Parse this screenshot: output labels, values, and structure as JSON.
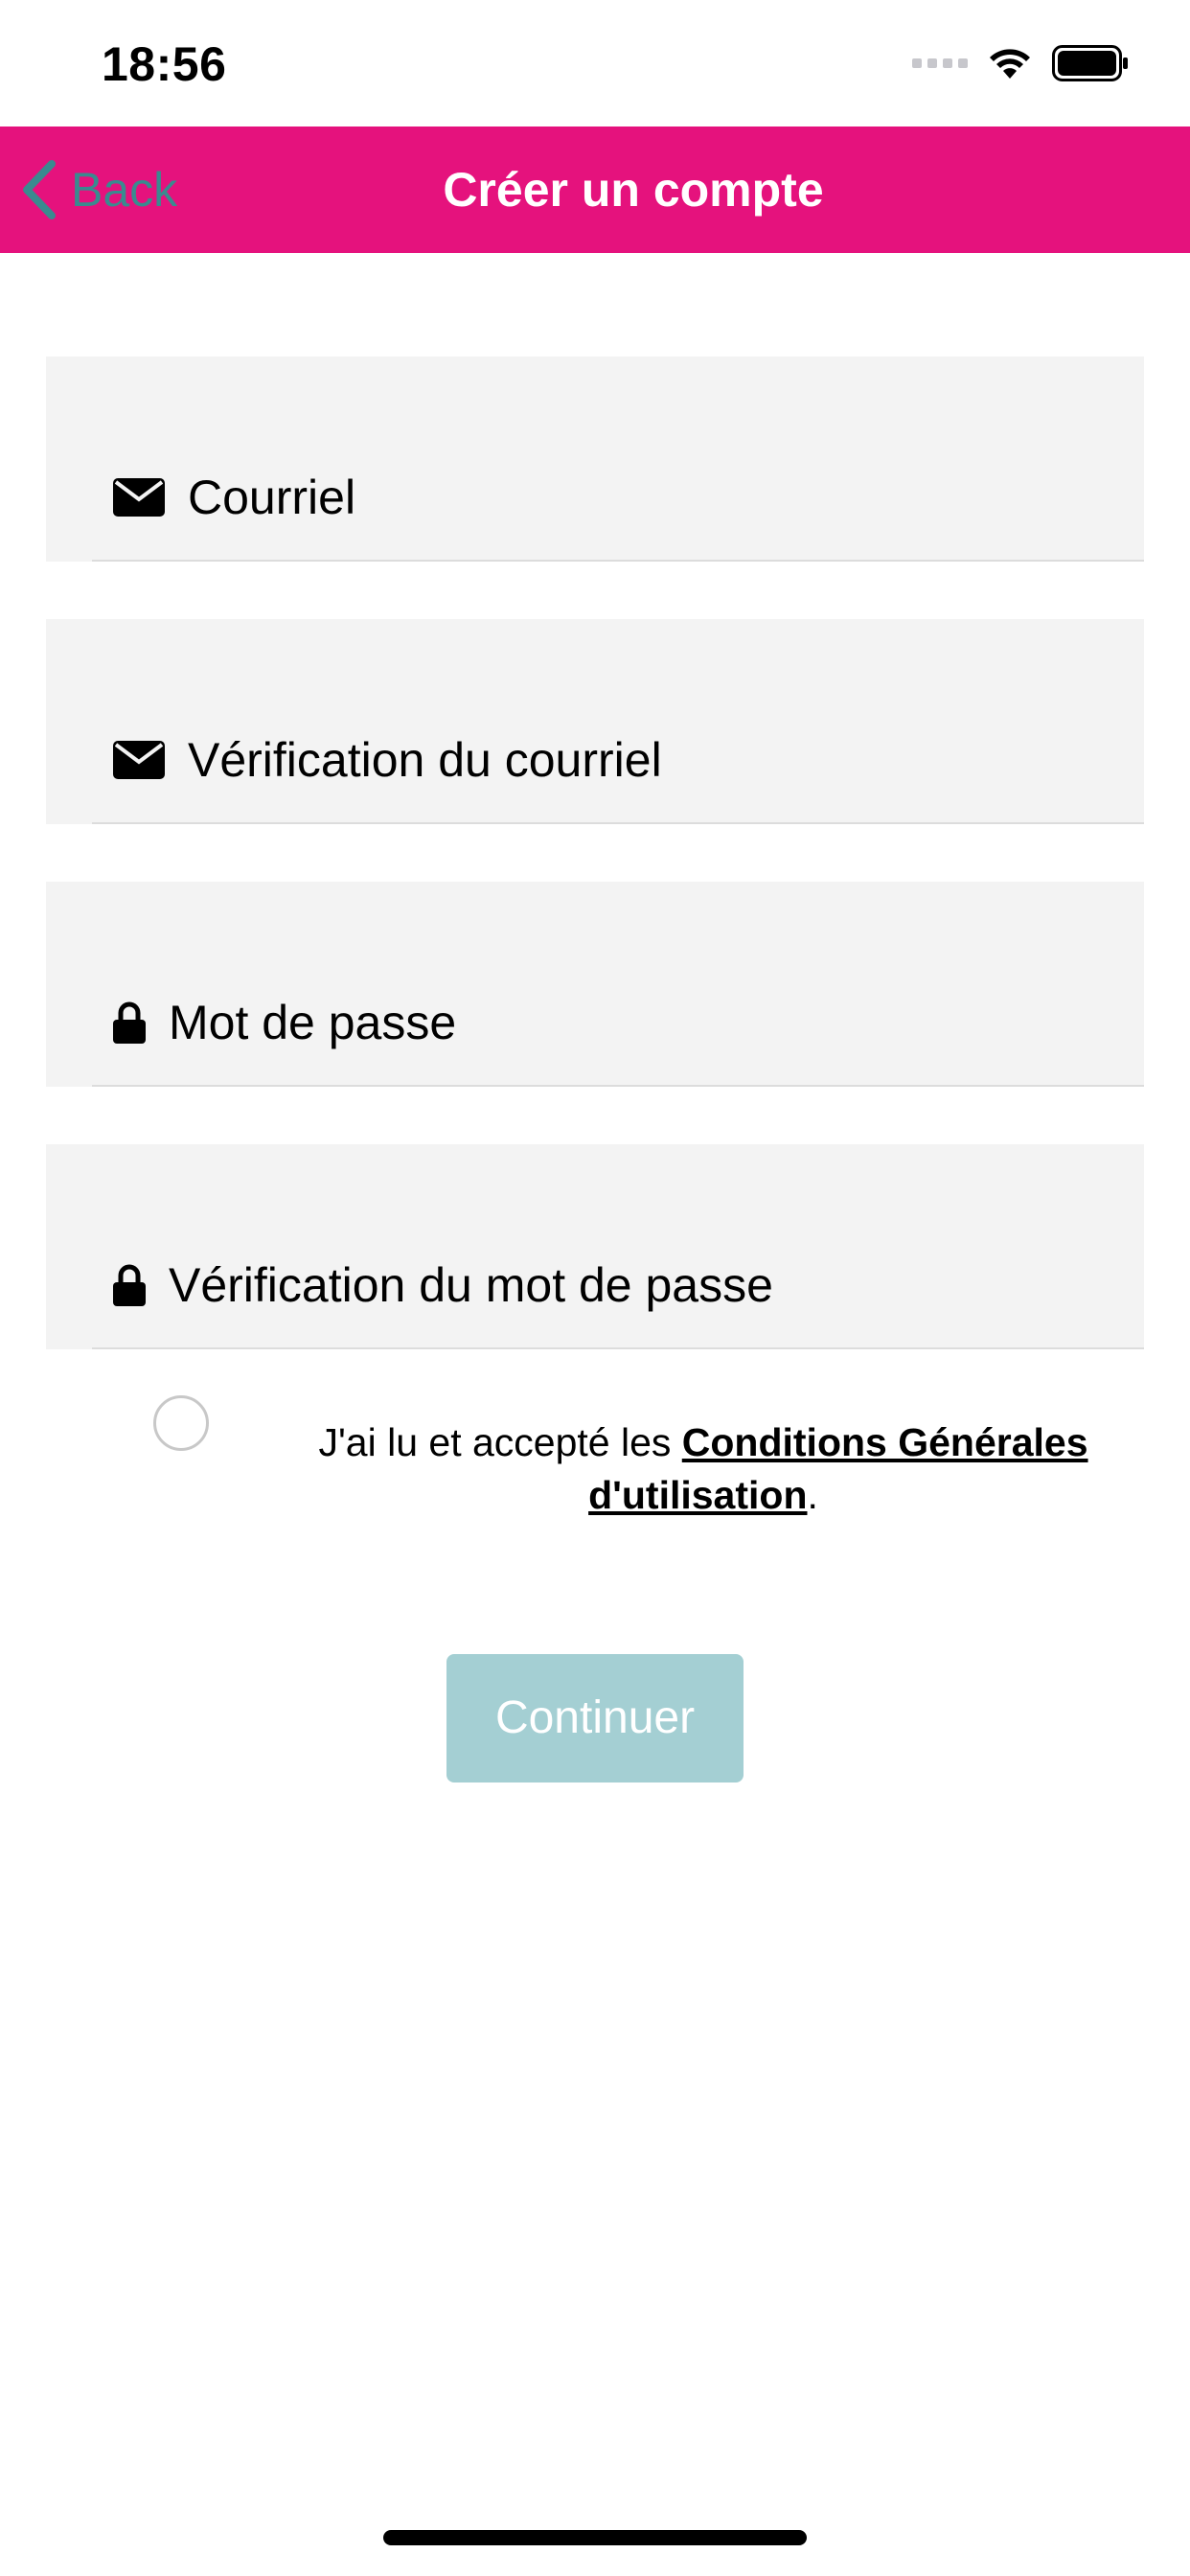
{
  "status_bar": {
    "time": "18:56"
  },
  "nav": {
    "back_label": "Back",
    "title": "Créer un compte",
    "background_color": "#e5127d"
  },
  "form": {
    "fields": [
      {
        "icon": "envelope-icon",
        "placeholder": "Courriel"
      },
      {
        "icon": "envelope-icon",
        "placeholder": "Vérification du courriel"
      },
      {
        "icon": "lock-icon",
        "placeholder": "Mot de passe"
      },
      {
        "icon": "lock-icon",
        "placeholder": "Vérification du mot de passe"
      }
    ],
    "terms": {
      "prefix": "J'ai lu et accepté les ",
      "link": "Conditions Générales d'utilisation",
      "suffix": ".",
      "checked": false
    },
    "continue_label": "Continuer",
    "continue_color": "#a4cfd3"
  }
}
